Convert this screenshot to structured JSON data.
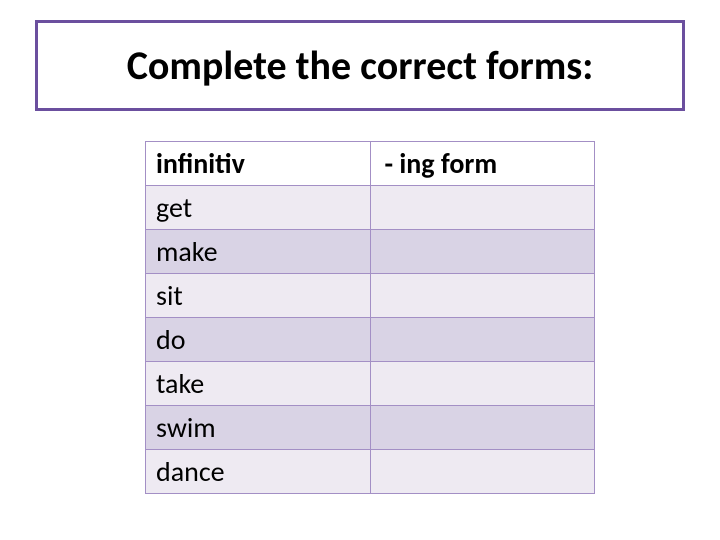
{
  "title": "Complete the correct forms:",
  "headers": {
    "col1": "infinitiv",
    "col2": "- ing form"
  },
  "rows": [
    {
      "infinitiv": "get",
      "ing": ""
    },
    {
      "infinitiv": "make",
      "ing": ""
    },
    {
      "infinitiv": "sit",
      "ing": ""
    },
    {
      "infinitiv": "do",
      "ing": ""
    },
    {
      "infinitiv": "take",
      "ing": ""
    },
    {
      "infinitiv": "swim",
      "ing": ""
    },
    {
      "infinitiv": "dance",
      "ing": ""
    }
  ]
}
